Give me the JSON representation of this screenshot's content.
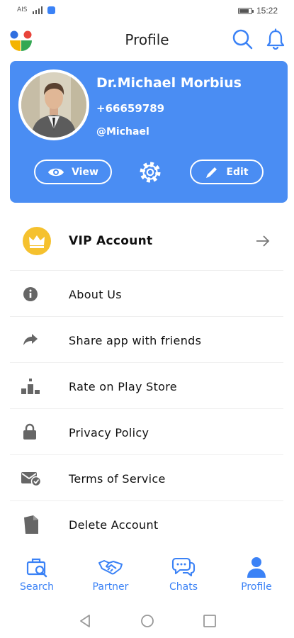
{
  "status_bar": {
    "carrier": "AIS",
    "battery_level": 0.8,
    "time": "15:22"
  },
  "header": {
    "title": "Profile",
    "logo_colors": [
      "#2f6fe0",
      "#e8443a",
      "#f4b400",
      "#34a853"
    ]
  },
  "profile": {
    "name": "Dr.Michael Morbius",
    "phone": "+66659789",
    "handle": "@Michael",
    "view_label": "View",
    "edit_label": "Edit"
  },
  "menu": {
    "vip_label": "VIP Account",
    "items": [
      {
        "label": "About Us",
        "icon": "info-icon"
      },
      {
        "label": "Share app with friends",
        "icon": "share-arrow-icon"
      },
      {
        "label": "Rate on Play Store",
        "icon": "podium-icon"
      },
      {
        "label": "Privacy Policy",
        "icon": "lock-icon"
      },
      {
        "label": "Terms of Service",
        "icon": "mail-check-icon"
      },
      {
        "label": "Delete Account",
        "icon": "document-icon"
      }
    ]
  },
  "bottom_nav": {
    "items": [
      {
        "label": "Search",
        "icon": "briefcase-search-icon"
      },
      {
        "label": "Partner",
        "icon": "handshake-icon"
      },
      {
        "label": "Chats",
        "icon": "chat-bubbles-icon"
      },
      {
        "label": "Profile",
        "icon": "person-icon"
      }
    ]
  },
  "colors": {
    "accent": "#3b82f6",
    "card": "#4a8df3",
    "vip": "#f5c12e",
    "icon_gray": "#666666"
  }
}
